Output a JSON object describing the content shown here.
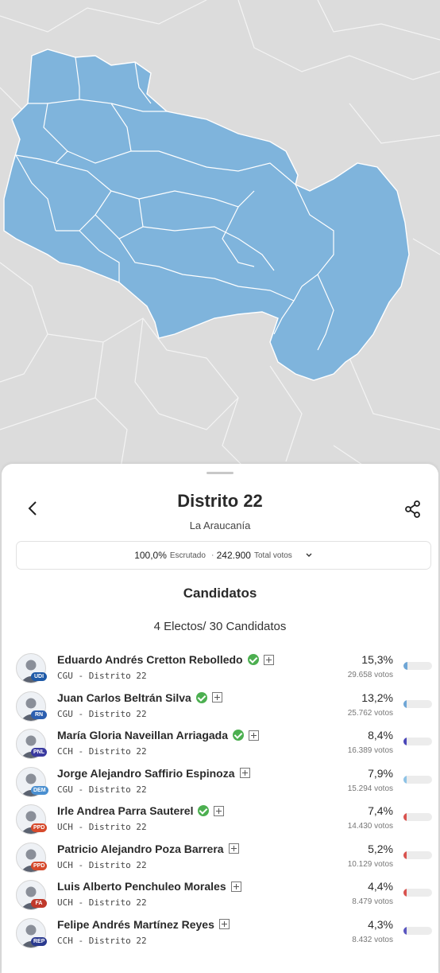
{
  "sheet": {
    "title": "Distrito 22",
    "region": "La Araucanía",
    "summary": {
      "pct": "100,0%",
      "pct_label": "Escrutado",
      "separator": "·",
      "total": "242.900",
      "total_label": "Total votos"
    },
    "heading": "Candidatos",
    "count": "4 Electos/ 30 Candidatos"
  },
  "icons": {
    "back": "chevron-left-icon",
    "share": "share-icon",
    "expand": "chevron-down-icon"
  },
  "colors": {
    "district_fill": "#7fb4dc",
    "map_bg": "#dcdcdc",
    "elected_check": "#4caf50"
  },
  "candidates": [
    {
      "name": "Eduardo Andrés Cretton Rebolledo",
      "elected": true,
      "party": "CGU - Distrito 22",
      "badge": "UDI",
      "badge_color": "#1e5aa8",
      "pct": "15,3%",
      "votes": "29.658 votos",
      "share": 0.153,
      "bar_color": "#6fa6d6"
    },
    {
      "name": "Juan Carlos Beltrán Silva",
      "elected": true,
      "party": "CGU - Distrito 22",
      "badge": "RN",
      "badge_color": "#2c5fb0",
      "pct": "13,2%",
      "votes": "25.762 votos",
      "share": 0.132,
      "bar_color": "#6fa6d6"
    },
    {
      "name": "María Gloria Naveillan Arriagada",
      "elected": true,
      "party": "CCH - Distrito 22",
      "badge": "PNL",
      "badge_color": "#3a3aa0",
      "pct": "8,4%",
      "votes": "16.389 votos",
      "share": 0.084,
      "bar_color": "#4a46b8"
    },
    {
      "name": "Jorge Alejandro Saffirio Espinoza",
      "elected": false,
      "party": "CGU - Distrito 22",
      "badge": "DEM",
      "badge_color": "#4a8fd0",
      "pct": "7,9%",
      "votes": "15.294 votos",
      "share": 0.079,
      "bar_color": "#8ec3e6"
    },
    {
      "name": "Irle Andrea Parra Sauterel",
      "elected": true,
      "party": "UCH - Distrito 22",
      "badge": "PPD",
      "badge_color": "#d64a2c",
      "pct": "7,4%",
      "votes": "14.430 votos",
      "share": 0.074,
      "bar_color": "#d9534f"
    },
    {
      "name": "Patricio Alejandro Poza Barrera",
      "elected": false,
      "party": "UCH - Distrito 22",
      "badge": "PPD",
      "badge_color": "#d64a2c",
      "pct": "5,2%",
      "votes": "10.129 votos",
      "share": 0.052,
      "bar_color": "#d9534f"
    },
    {
      "name": "Luis Alberto Penchuleo Morales",
      "elected": false,
      "party": "UCH - Distrito 22",
      "badge": "FA",
      "badge_color": "#c0392b",
      "pct": "4,4%",
      "votes": "8.479 votos",
      "share": 0.044,
      "bar_color": "#d9534f"
    },
    {
      "name": "Felipe Andrés Martínez Reyes",
      "elected": false,
      "party": "CCH - Distrito 22",
      "badge": "REP",
      "badge_color": "#2b3a8f",
      "pct": "4,3%",
      "votes": "8.432 votos",
      "share": 0.043,
      "bar_color": "#5a56c0"
    }
  ]
}
